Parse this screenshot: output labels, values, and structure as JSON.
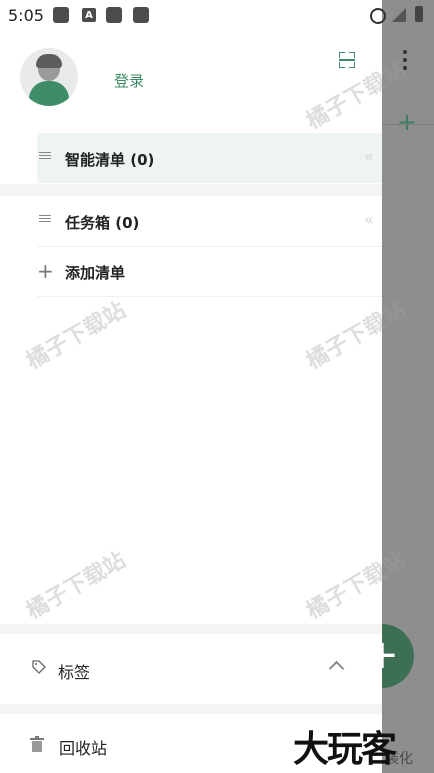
{
  "status_bar": {
    "time": "5:05",
    "notif_badge_letter": "A"
  },
  "drawer": {
    "login_label": "登录",
    "smart_list_label": "智能清单 (0)",
    "inbox_label": "任务箱 (0)",
    "add_list_label": "添加清单",
    "collapse_chevron": "«",
    "tags_label": "标签",
    "trash_label": "回收站"
  },
  "background_app": {
    "bottom_text": "装化"
  },
  "watermark": {
    "text": "橘子下载站",
    "logo": "大玩客"
  },
  "colors": {
    "accent": "#3d8a66",
    "selected_row": "#eef4f1",
    "scrim": "#8e8e8e"
  }
}
